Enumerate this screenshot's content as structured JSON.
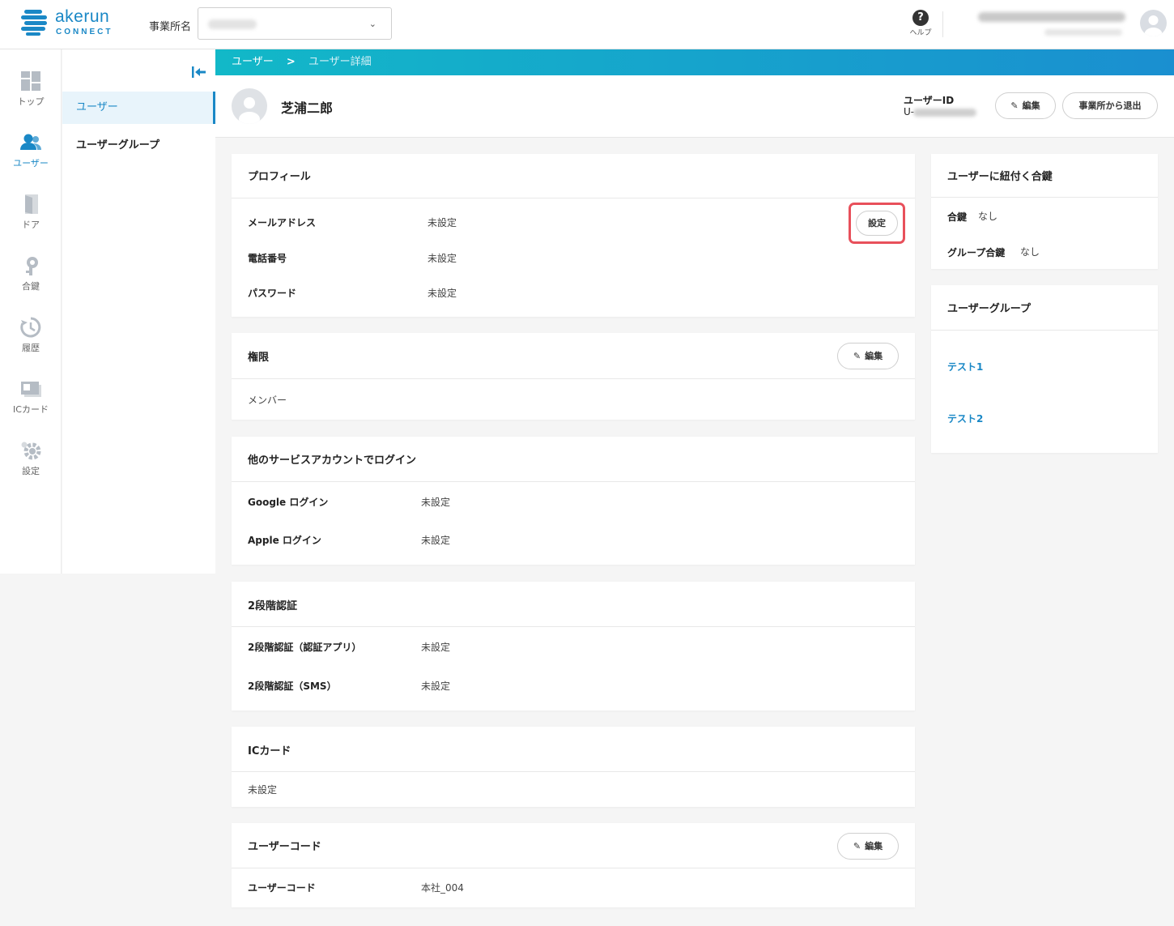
{
  "header": {
    "logo_text": "akerun",
    "logo_subtext": "CONNECT",
    "office_label": "事業所名",
    "help_label": "ヘルプ"
  },
  "icon_nav": [
    {
      "label": "トップ",
      "icon": "dashboard-icon"
    },
    {
      "label": "ユーザー",
      "icon": "users-icon",
      "active": true
    },
    {
      "label": "ドア",
      "icon": "door-icon"
    },
    {
      "label": "合鍵",
      "icon": "key-icon"
    },
    {
      "label": "履歴",
      "icon": "history-icon"
    },
    {
      "label": "ICカード",
      "icon": "ic-card-icon"
    },
    {
      "label": "設定",
      "icon": "gear-icon"
    }
  ],
  "sub_nav": [
    {
      "label": "ユーザー",
      "active": true
    },
    {
      "label": "ユーザーグループ"
    }
  ],
  "breadcrumb": {
    "parent": "ユーザー",
    "separator": ">",
    "current": "ユーザー詳細"
  },
  "user": {
    "name": "芝浦二郎",
    "id_label": "ユーザーID",
    "id_prefix": "U-",
    "edit_label": "編集",
    "leave_label": "事業所から退出"
  },
  "profile": {
    "title": "プロフィール",
    "set_label": "設定",
    "rows": [
      {
        "label": "メールアドレス",
        "value": "未設定"
      },
      {
        "label": "電話番号",
        "value": "未設定"
      },
      {
        "label": "パスワード",
        "value": "未設定"
      }
    ]
  },
  "permission": {
    "title": "権限",
    "edit_label": "編集",
    "value": "メンバー"
  },
  "service_login": {
    "title": "他のサービスアカウントでログイン",
    "rows": [
      {
        "label": "Google ログイン",
        "value": "未設定"
      },
      {
        "label": "Apple ログイン",
        "value": "未設定"
      }
    ]
  },
  "two_factor": {
    "title": "2段階認証",
    "rows": [
      {
        "label": "2段階認証（認証アプリ）",
        "value": "未設定"
      },
      {
        "label": "2段階認証（SMS）",
        "value": "未設定"
      }
    ]
  },
  "ic_card": {
    "title": "ICカード",
    "value": "未設定"
  },
  "user_code": {
    "title": "ユーザーコード",
    "edit_label": "編集",
    "row_label": "ユーザーコード",
    "row_value": "本社_004"
  },
  "keys": {
    "title": "ユーザーに紐付く合鍵",
    "rows": [
      {
        "label": "合鍵",
        "value": "なし"
      },
      {
        "label": "グループ合鍵",
        "value": "なし"
      }
    ]
  },
  "user_groups": {
    "title": "ユーザーグループ",
    "items": [
      "テスト1",
      "テスト2"
    ]
  },
  "colors": {
    "accent": "#1a88c6",
    "highlight": "#e8505b"
  }
}
